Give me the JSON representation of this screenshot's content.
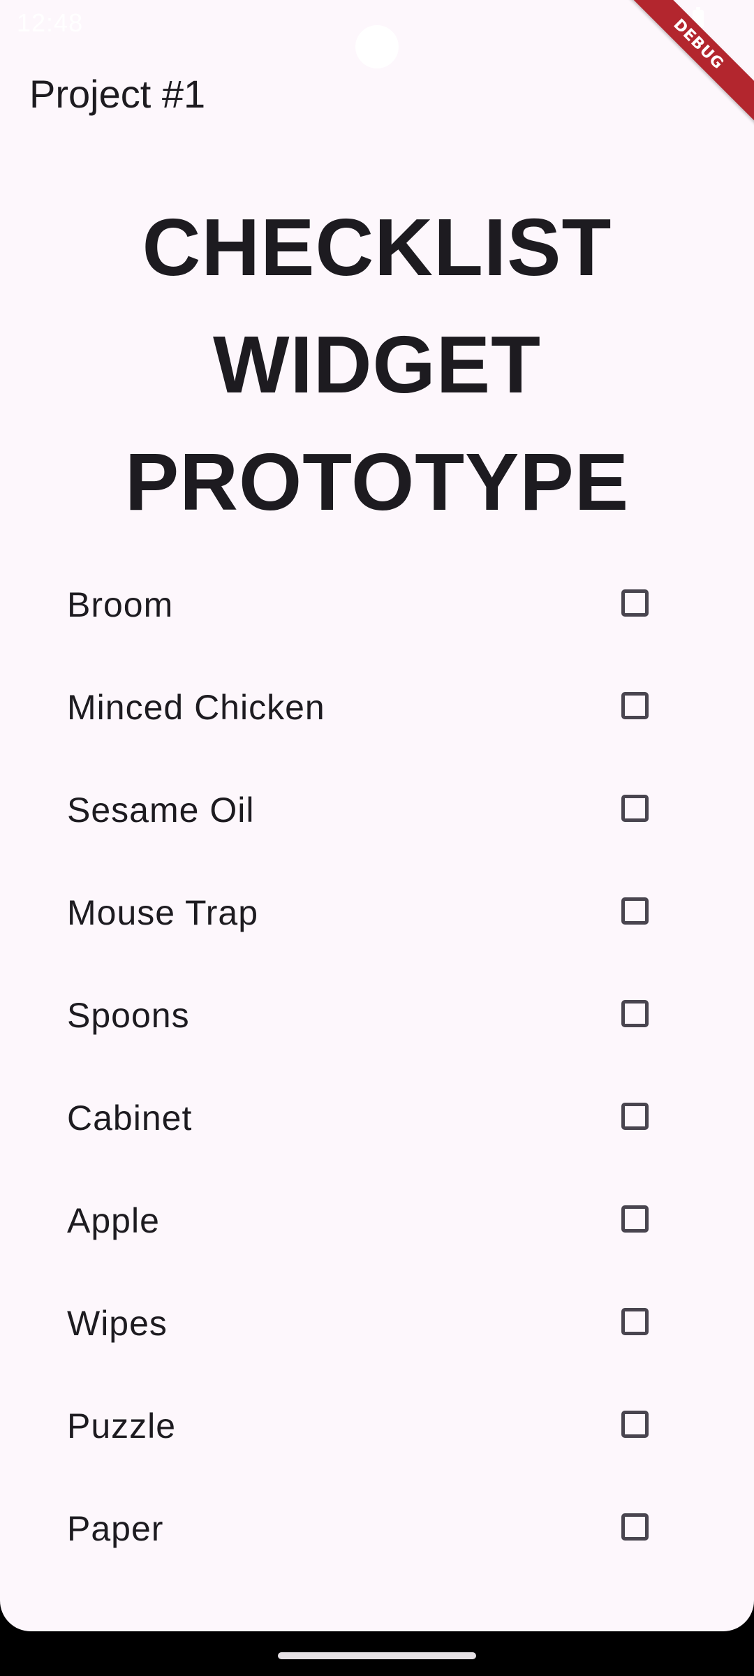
{
  "status_bar": {
    "time": "12:48"
  },
  "debug_banner": {
    "label": "DEBUG",
    "color": "#B3262E"
  },
  "app_bar": {
    "title": "Project #1"
  },
  "headline": {
    "lines": [
      "CHECKLIST",
      "WIDGET",
      "PROTOTYPE"
    ]
  },
  "checklist": {
    "items": [
      {
        "label": "Broom",
        "checked": false
      },
      {
        "label": "Minced Chicken",
        "checked": false
      },
      {
        "label": "Sesame Oil",
        "checked": false
      },
      {
        "label": "Mouse Trap",
        "checked": false
      },
      {
        "label": "Spoons",
        "checked": false
      },
      {
        "label": "Cabinet",
        "checked": false
      },
      {
        "label": "Apple",
        "checked": false
      },
      {
        "label": "Wipes",
        "checked": false
      },
      {
        "label": "Puzzle",
        "checked": false
      },
      {
        "label": "Paper",
        "checked": false
      }
    ]
  },
  "colors": {
    "background": "#FDF7FC",
    "text": "#1D1B20",
    "checkbox_border": "#49454F"
  }
}
